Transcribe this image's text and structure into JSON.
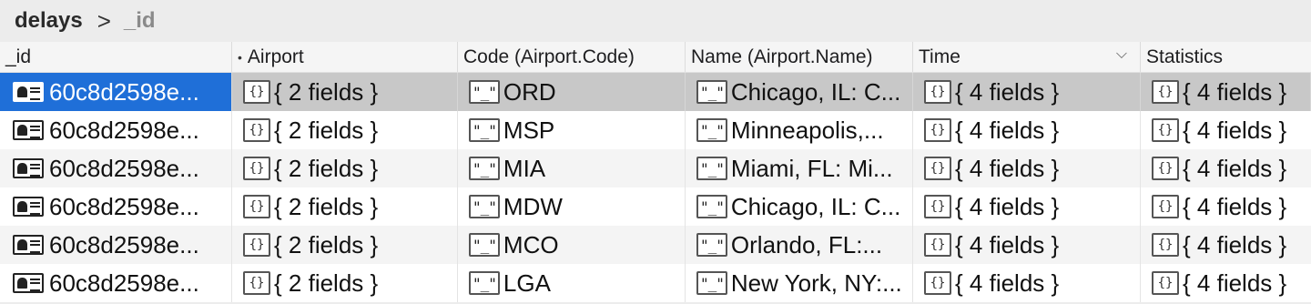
{
  "breadcrumb": {
    "collection": "delays",
    "separator": ">",
    "field": "_id"
  },
  "columns": [
    "_id",
    "Airport",
    "Code (Airport.Code)",
    "Name (Airport.Name)",
    "Time",
    "Statistics"
  ],
  "rows": [
    {
      "id": "60c8d2598e...",
      "airport": "{ 2 fields }",
      "code": "ORD",
      "name": "Chicago, IL: C...",
      "time": "{ 4 fields }",
      "statistics": "{ 4 fields }"
    },
    {
      "id": "60c8d2598e...",
      "airport": "{ 2 fields }",
      "code": "MSP",
      "name": "Minneapolis,...",
      "time": "{ 4 fields }",
      "statistics": "{ 4 fields }"
    },
    {
      "id": "60c8d2598e...",
      "airport": "{ 2 fields }",
      "code": "MIA",
      "name": "Miami, FL: Mi...",
      "time": "{ 4 fields }",
      "statistics": "{ 4 fields }"
    },
    {
      "id": "60c8d2598e...",
      "airport": "{ 2 fields }",
      "code": "MDW",
      "name": "Chicago, IL: C...",
      "time": "{ 4 fields }",
      "statistics": "{ 4 fields }"
    },
    {
      "id": "60c8d2598e...",
      "airport": "{ 2 fields }",
      "code": "MCO",
      "name": "Orlando, FL:...",
      "time": "{ 4 fields }",
      "statistics": "{ 4 fields }"
    },
    {
      "id": "60c8d2598e...",
      "airport": "{ 2 fields }",
      "code": "LGA",
      "name": "New York, NY:...",
      "time": "{ 4 fields }",
      "statistics": "{ 4 fields }"
    }
  ],
  "icons": {
    "object": "{}",
    "string": "\"_\""
  },
  "colors": {
    "selection": "#1f6fd8",
    "selected_row": "#c8c8c8"
  }
}
